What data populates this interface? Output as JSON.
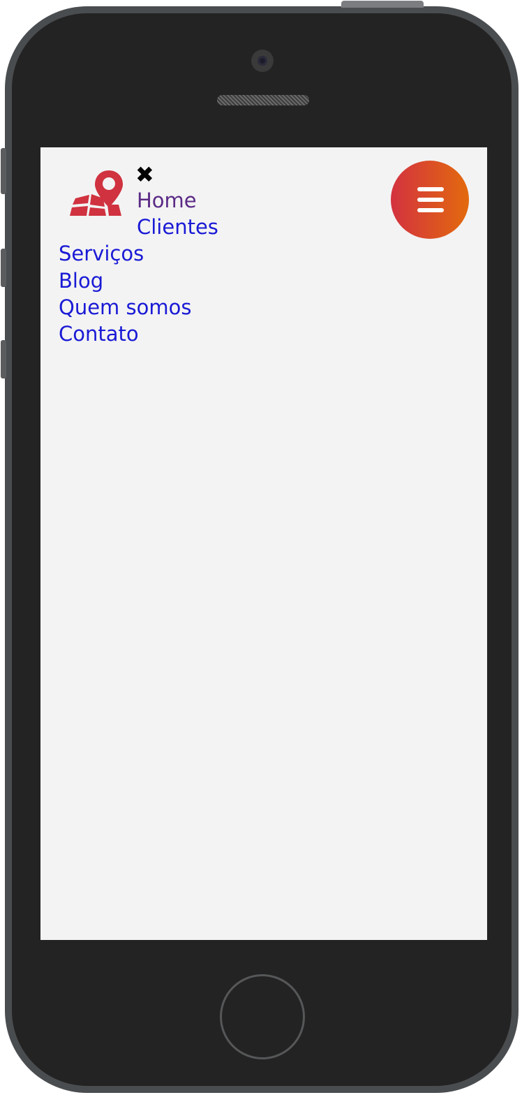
{
  "nav": {
    "close_symbol": "✖",
    "links": [
      {
        "label": "Home",
        "color": "#5b2a86",
        "visited": true
      },
      {
        "label": "Clientes",
        "color": "#1a1ad6"
      },
      {
        "label": "Serviços",
        "color": "#1a1ad6"
      },
      {
        "label": "Blog",
        "color": "#1a1ad6"
      },
      {
        "label": "Quem somos",
        "color": "#1a1ad6"
      },
      {
        "label": "Contato",
        "color": "#1a1ad6"
      }
    ]
  },
  "logo": {
    "icon": "map-pin-icon",
    "color": "#d0323f"
  },
  "menu_button": {
    "icon": "hamburger-menu-icon",
    "gradient_start": "#d3323f",
    "gradient_end": "#e36a0e"
  },
  "theme": {
    "screen_background": "#f3f3f3"
  }
}
